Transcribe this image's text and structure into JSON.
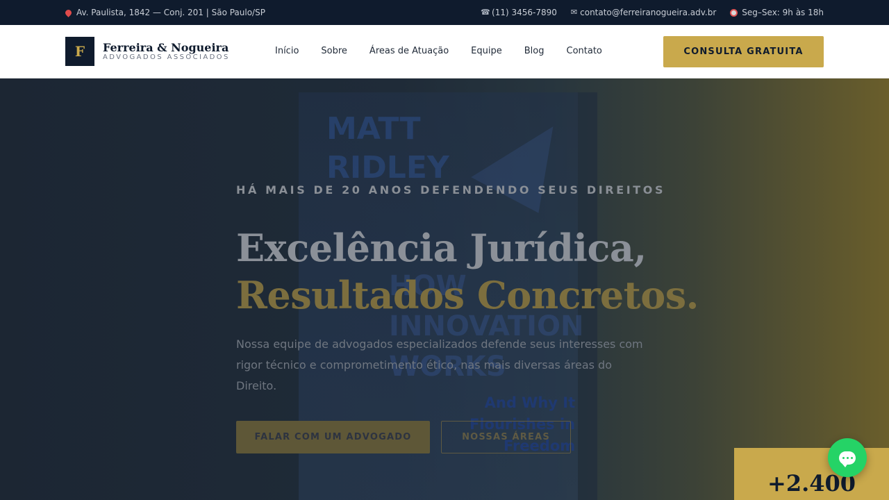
{
  "topbar": {
    "address": "Av. Paulista, 1842 — Conj. 201 | São Paulo/SP",
    "phone": "(11) 3456-7890",
    "email": "contato@ferreiranogueira.adv.br",
    "hours": "Seg–Sex: 9h às 18h"
  },
  "header": {
    "logo_letter": "F",
    "logo_name": "Ferreira & Nogueira",
    "logo_subtitle": "ADVOGADOS ASSOCIADOS",
    "nav": [
      "Início",
      "Sobre",
      "Áreas de Atuação",
      "Equipe",
      "Blog",
      "Contato"
    ],
    "cta_label": "CONSULTA GRATUITA"
  },
  "hero": {
    "eyebrow": "HÁ MAIS DE 20 ANOS DEFENDENDO SEUS DIREITOS",
    "headline_line1": "Excelência Jurídica,",
    "headline_line2": "Resultados Concretos.",
    "lead": "Nossa equipe de advogados especializados defende seus interesses com rigor técnico e comprometimento ético, nas mais diversas áreas do Direito.",
    "primary_button": "FALAR COM UM ADVOGADO",
    "secondary_button": "NOSSAS ÁREAS",
    "background_book": {
      "author": "MATT\nRIDLEY",
      "title": "HOW\nINNOVATION\nWORKS",
      "subtitle": "And Why It\nFlourishes in\nFreedom"
    }
  },
  "stat_card": {
    "number": "+2.400"
  },
  "colors": {
    "navy": "#0f1b2d",
    "gold": "#c9a94c",
    "whatsapp": "#25d366"
  },
  "icons": [
    "map-pin-icon",
    "phone-icon",
    "mail-icon",
    "clock-icon",
    "chat-icon"
  ]
}
